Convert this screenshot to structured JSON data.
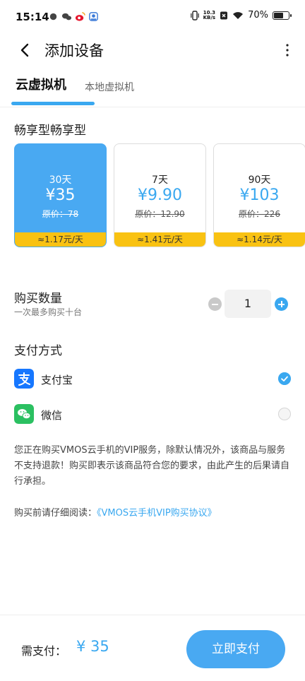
{
  "status_bar": {
    "time": "15:14",
    "net_speed_value": "10.3",
    "net_speed_unit": "KB/s",
    "battery": "70%",
    "battery_level": 0.7
  },
  "header": {
    "title": "添加设备",
    "back_icon": "chevron-left-icon",
    "more_icon": "more-vertical-icon"
  },
  "tabs": [
    {
      "label": "云虚拟机",
      "active": true
    },
    {
      "label": "本地虚拟机",
      "active": false
    }
  ],
  "plan_section": {
    "title": "畅享型畅享型",
    "plans": [
      {
        "days": "30天",
        "price": "¥35",
        "original": "原价：78",
        "per_day": "≈1.17元/天",
        "selected": true
      },
      {
        "days": "7天",
        "price": "¥9.90",
        "original": "原价：12.90",
        "per_day": "≈1.41元/天",
        "selected": false
      },
      {
        "days": "90天",
        "price": "¥103",
        "original": "原价：226",
        "per_day": "≈1.14元/天",
        "selected": false
      }
    ]
  },
  "quantity": {
    "title": "购买数量",
    "subtitle": "一次最多购买十台",
    "value": "1"
  },
  "payment": {
    "title": "支付方式",
    "methods": [
      {
        "label": "支付宝",
        "icon": "alipay-icon",
        "selected": true
      },
      {
        "label": "微信",
        "icon": "wechat-icon",
        "selected": false
      }
    ]
  },
  "notice": "您正在购买VMOS云手机的VIP服务，除默认情况外，该商品与服务不支持退款！购买即表示该商品符合您的要求，由此产生的后果请自行承担。",
  "agreement": {
    "prefix": "购买前请仔细阅读：",
    "link": "《VMOS云手机VIP购买协议》"
  },
  "footer": {
    "need_pay_label": "需支付：",
    "amount": "¥ 35",
    "pay_button": "立即支付"
  },
  "colors": {
    "accent": "#3aa8f0",
    "selected_card": "#49a9f2",
    "per_day_bar": "#f9c212",
    "alipay": "#1677ff",
    "wechat": "#2bc061"
  }
}
